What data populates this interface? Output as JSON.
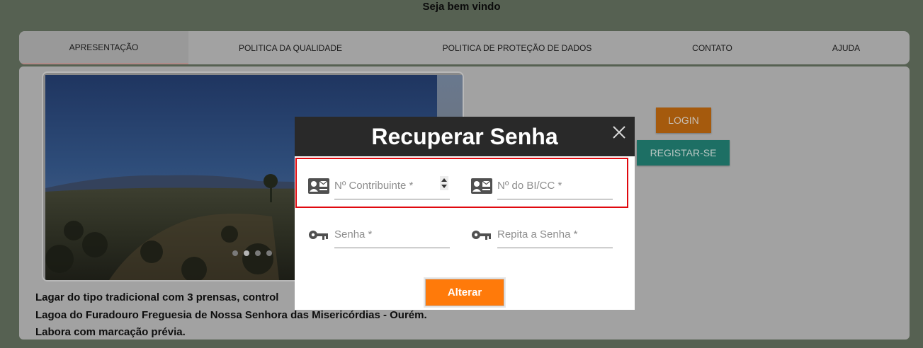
{
  "header": {
    "welcome": "Seja bem vindo"
  },
  "nav": {
    "items": [
      {
        "label": "APRESENTAÇÃO",
        "active": true
      },
      {
        "label": "POLITICA DA QUALIDADE",
        "active": false
      },
      {
        "label": "POLITICA DE PROTEÇÃO DE DADOS",
        "active": false
      },
      {
        "label": "CONTATO",
        "active": false
      },
      {
        "label": "AJUDA",
        "active": false
      }
    ]
  },
  "slider": {
    "slide_count": 4,
    "active_index": 1
  },
  "description": {
    "line1": "Lagar do tipo tradicional com 3 prensas, control",
    "line2": "Lagoa do Furadouro Freguesia de Nossa Senhora das Misericórdias - Ourém.",
    "line3": "Labora com marcação prévia."
  },
  "auth": {
    "login_label": "LOGIN",
    "register_label": "REGISTAR-SE"
  },
  "modal": {
    "title": "Recuperar Senha",
    "close_icon": "close-icon",
    "fields": {
      "contribuinte_placeholder": "Nº Contribuinte *",
      "bi_placeholder": "Nº do BI/CC *",
      "senha_placeholder": "Senha *",
      "repita_placeholder": "Repita a Senha *"
    },
    "submit_label": "Alterar"
  },
  "colors": {
    "overlay_bg": "#566152",
    "modal_header": "#292929",
    "highlight_border": "#e0080e",
    "submit_button": "#ff7a0a",
    "login_button": "#a55a0d",
    "register_button": "#1d6f64"
  }
}
